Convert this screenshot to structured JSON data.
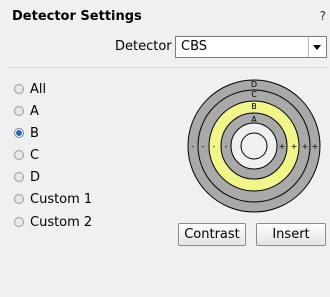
{
  "window": {
    "title": "Detector Settings",
    "help_glyph": "?"
  },
  "detector": {
    "label": "Detector",
    "selected": "CBS"
  },
  "segments": {
    "options": [
      "All",
      "A",
      "B",
      "C",
      "D",
      "Custom 1",
      "Custom 2"
    ],
    "selected": "B"
  },
  "diagram": {
    "ring_labels": [
      "D",
      "C",
      "B",
      "A"
    ],
    "left_signs": [
      "-",
      "-",
      "-",
      "-"
    ],
    "right_signs": [
      "+",
      "+",
      "+",
      "+"
    ],
    "highlight_ring": "B",
    "colors": {
      "ring": "#a9a9a9",
      "highlight": "#f2f58a",
      "outline": "#000000"
    }
  },
  "buttons": {
    "contrast": "Contrast",
    "insert": "Insert"
  }
}
